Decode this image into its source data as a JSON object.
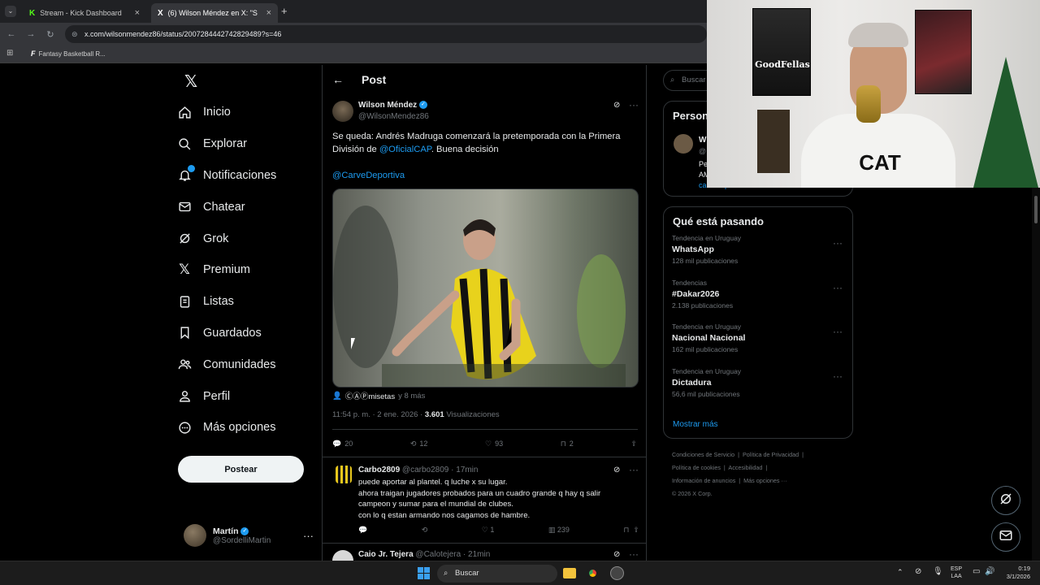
{
  "browser": {
    "tabs": [
      {
        "title": "Stream - Kick Dashboard",
        "favicon": "K"
      },
      {
        "title": "(6) Wilson Méndez en X: \"Se qu",
        "favicon": "X"
      }
    ],
    "new_tab": "+",
    "url": "x.com/wilsonmendez86/status/2007284442742829489?s=46",
    "bookmark": "Fantasy Basketball R..."
  },
  "sidebar": {
    "items": [
      {
        "label": "Inicio",
        "icon": "home-icon"
      },
      {
        "label": "Explorar",
        "icon": "search-icon"
      },
      {
        "label": "Notificaciones",
        "icon": "bell-icon"
      },
      {
        "label": "Chatear",
        "icon": "mail-icon"
      },
      {
        "label": "Grok",
        "icon": "grok-icon"
      },
      {
        "label": "Premium",
        "icon": "x-logo-icon"
      },
      {
        "label": "Listas",
        "icon": "list-icon"
      },
      {
        "label": "Guardados",
        "icon": "bookmark-icon"
      },
      {
        "label": "Comunidades",
        "icon": "people-icon"
      },
      {
        "label": "Perfil",
        "icon": "person-icon"
      },
      {
        "label": "Más opciones",
        "icon": "more-circle-icon"
      }
    ],
    "post_button": "Postear",
    "account": {
      "name": "Martín",
      "handle": "@SordelliMartin"
    }
  },
  "post": {
    "header_title": "Post",
    "author": {
      "name": "Wilson Méndez",
      "handle": "@WilsonMendez86"
    },
    "text_line1": "Se queda: Andrés Madruga comenzará la pretemporada con la Primera",
    "text_line2_before": "División de ",
    "text_line2_mention": "@OficialCAP",
    "text_line2_after": ". Buena decisión",
    "mention2": "@CarveDeportiva",
    "tagged": "ⒸⒶⓅmisetas",
    "tagged_suffix": "y 8 más",
    "time": "11:54 p. m. · 2 ene. 2026 ·",
    "views_count": "3.601",
    "views_label": "Visualizaciones",
    "stats": {
      "replies": "20",
      "reposts": "12",
      "likes": "93",
      "bookmarks": "2"
    }
  },
  "replies": [
    {
      "name": "Carbo2809",
      "handle_time": "@carbo2809 · 17min",
      "lines": [
        "puede aportar al plantel. q luche x su lugar.",
        "ahora traigan jugadores probados para un cuadro grande q hay q salir",
        "campeon y sumar para el mundial de clubes.",
        "con lo q estan armando nos cagamos de hambre."
      ],
      "likes": "1",
      "views": "239"
    },
    {
      "name": "Caio Jr. Tejera",
      "handle_time": "@Calotejera · 21min"
    }
  ],
  "right_panel": {
    "search_placeholder": "Buscar",
    "who_to_follow_title": "Person",
    "suggest_name": "W",
    "suggest_handle": "@",
    "suggest_bio1": "Pe",
    "suggest_bio2": "AM",
    "suggest_link": "carvedeportiva",
    "trending_title": "Qué está pasando",
    "trends": [
      {
        "context": "Tendencia en Uruguay",
        "name": "WhatsApp",
        "count": "128 mil publicaciones"
      },
      {
        "context": "Tendencias",
        "name": "#Dakar2026",
        "count": "2.138 publicaciones"
      },
      {
        "context": "Tendencia en Uruguay",
        "name": "Nacional Nacional",
        "count": "162 mil publicaciones"
      },
      {
        "context": "Tendencia en Uruguay",
        "name": "Dictadura",
        "count": "56,6 mil publicaciones"
      }
    ],
    "show_more": "Mostrar más",
    "footer": {
      "line1": [
        "Condiciones de Servicio",
        "Política de Privacidad"
      ],
      "line2": [
        "Política de cookies",
        "Accesibilidad"
      ],
      "line3": [
        "Información de anuncios",
        "Más opciones ···"
      ],
      "copyright": "© 2026 X Corp."
    }
  },
  "webcam": {
    "poster1": "GoodFellas",
    "shirt": "CAT"
  },
  "taskbar": {
    "search": "Buscar",
    "lang_top": "ESP",
    "lang_bottom": "LAA",
    "time": "0:19",
    "date": "3/1/2026"
  },
  "colors": {
    "accent": "#1d9bf0",
    "background": "#000000",
    "border": "#2f3336",
    "muted": "#71767b"
  }
}
